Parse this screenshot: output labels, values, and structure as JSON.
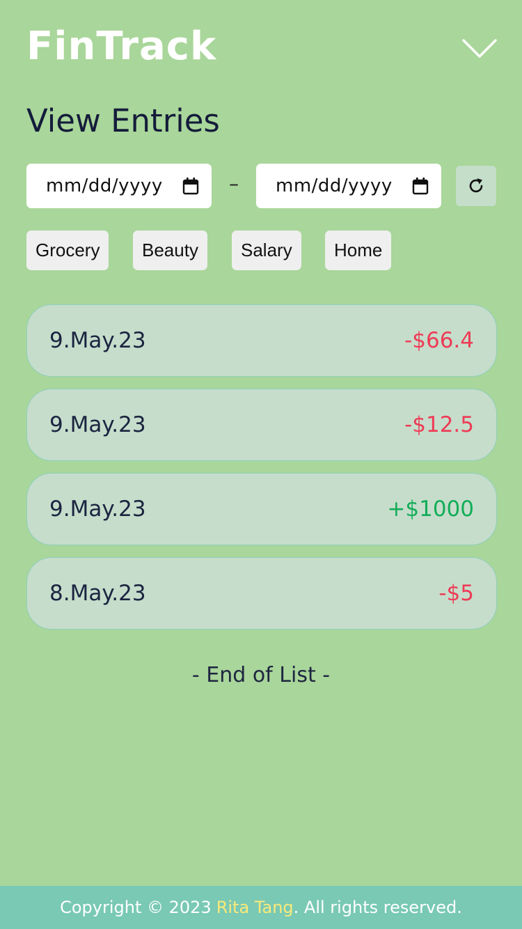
{
  "app": {
    "title": "FinTrack"
  },
  "header": {
    "menu_icon": "chevron-down-icon"
  },
  "page": {
    "title": "View Entries"
  },
  "filters": {
    "date_from": {
      "placeholder": "mm/dd/yyyy",
      "icon": "calendar-icon"
    },
    "separator": "–",
    "date_to": {
      "placeholder": "mm/dd/yyyy",
      "icon": "calendar-icon"
    },
    "refresh_icon": "refresh-icon",
    "categories": [
      "Grocery",
      "Beauty",
      "Salary",
      "Home"
    ]
  },
  "entries": [
    {
      "date": "9.May.23",
      "amount": "-$66.4",
      "type": "expense"
    },
    {
      "date": "9.May.23",
      "amount": "-$12.5",
      "type": "expense"
    },
    {
      "date": "9.May.23",
      "amount": "+$1000",
      "type": "income"
    },
    {
      "date": "8.May.23",
      "amount": "-$5",
      "type": "expense"
    }
  ],
  "list_end": "- End of List -",
  "footer": {
    "prefix": "Copyright © 2023",
    "author": "Rita Tang",
    "suffix": ". All rights reserved."
  },
  "colors": {
    "background": "#a9d69a",
    "expense": "#ee3b56",
    "income": "#12ad58",
    "footer": "#79c9b4",
    "author": "#f9ea7a"
  }
}
